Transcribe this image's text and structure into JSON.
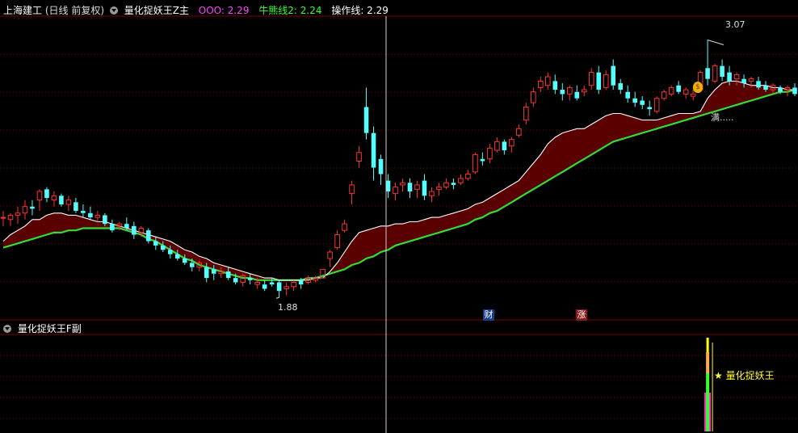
{
  "main_header": {
    "symbol": "上海建工",
    "period": "(日线 前复权)",
    "indicator": "量化捉妖王Z主",
    "ooo_label": "OOO: 2.29",
    "bear_label": "牛熊线2: 2.24",
    "op_label": "操作线: 2.29"
  },
  "sub_header": {
    "indicator": "量化捉妖王F副"
  },
  "annotations": {
    "high": "3.07",
    "low": "1.88",
    "full_text": "满.....",
    "cai_badge": "财",
    "zhang_badge": "涨",
    "signal_text": "★ 量化捉妖王"
  },
  "colors": {
    "up": "#ff3232",
    "down": "#54ffff",
    "green_line": "#33dd33",
    "white_line": "#ffffff",
    "fill_red": "#5a0000",
    "fill_green": "#0d4d0d",
    "grid": "#800000",
    "ooo_color": "#ff44ff",
    "bear_color": "#33ff33",
    "signal_yellow": "#ffff00",
    "signal_pink": "#ff33cc",
    "signal_green": "#33ff33",
    "signal_orange": "#ffaa55"
  },
  "chart_data": {
    "type": "candlestick",
    "series": [
      {
        "name": "ohlc",
        "values": [
          [
            2.25,
            2.28,
            2.21,
            2.25
          ],
          [
            2.24,
            2.27,
            2.21,
            2.26
          ],
          [
            2.26,
            2.3,
            2.22,
            2.27
          ],
          [
            2.27,
            2.33,
            2.24,
            2.3
          ],
          [
            2.3,
            2.33,
            2.26,
            2.29
          ],
          [
            2.33,
            2.38,
            2.28,
            2.37
          ],
          [
            2.38,
            2.39,
            2.32,
            2.34
          ],
          [
            2.33,
            2.37,
            2.3,
            2.35
          ],
          [
            2.35,
            2.36,
            2.3,
            2.31
          ],
          [
            2.31,
            2.35,
            2.28,
            2.33
          ],
          [
            2.32,
            2.34,
            2.27,
            2.28
          ],
          [
            2.28,
            2.31,
            2.25,
            2.27
          ],
          [
            2.27,
            2.3,
            2.24,
            2.25
          ],
          [
            2.25,
            2.28,
            2.23,
            2.26
          ],
          [
            2.26,
            2.27,
            2.21,
            2.22
          ],
          [
            2.22,
            2.24,
            2.18,
            2.19
          ],
          [
            2.21,
            2.23,
            2.19,
            2.22
          ],
          [
            2.22,
            2.25,
            2.19,
            2.2
          ],
          [
            2.21,
            2.23,
            2.15,
            2.17
          ],
          [
            2.18,
            2.21,
            2.16,
            2.2
          ],
          [
            2.19,
            2.2,
            2.13,
            2.14
          ],
          [
            2.14,
            2.16,
            2.1,
            2.12
          ],
          [
            2.12,
            2.14,
            2.09,
            2.1
          ],
          [
            2.1,
            2.12,
            2.06,
            2.08
          ],
          [
            2.08,
            2.1,
            2.05,
            2.06
          ],
          [
            2.06,
            2.08,
            2.03,
            2.04
          ],
          [
            2.04,
            2.06,
            2.0,
            2.02
          ],
          [
            2.02,
            2.05,
            2.0,
            2.04
          ],
          [
            2.02,
            2.04,
            1.95,
            1.97
          ],
          [
            2.01,
            2.03,
            1.96,
            1.99
          ],
          [
            1.99,
            2.02,
            1.97,
            2.0
          ],
          [
            2.0,
            2.02,
            1.96,
            1.97
          ],
          [
            1.97,
            1.99,
            1.94,
            1.95
          ],
          [
            1.95,
            1.99,
            1.93,
            1.98
          ],
          [
            1.97,
            1.99,
            1.94,
            1.96
          ],
          [
            1.94,
            1.97,
            1.92,
            1.95
          ],
          [
            1.94,
            1.96,
            1.91,
            1.92
          ],
          [
            1.95,
            1.97,
            1.93,
            1.94
          ],
          [
            1.95,
            1.96,
            1.88,
            1.91
          ],
          [
            1.92,
            1.95,
            1.89,
            1.93
          ],
          [
            1.93,
            1.96,
            1.91,
            1.95
          ],
          [
            1.96,
            1.97,
            1.92,
            1.94
          ],
          [
            1.95,
            1.98,
            1.94,
            1.97
          ],
          [
            1.96,
            1.98,
            1.95,
            1.97
          ],
          [
            1.97,
            2.01,
            1.97,
            2.01
          ],
          [
            2.06,
            2.1,
            2.02,
            2.09
          ],
          [
            2.11,
            2.19,
            2.1,
            2.17
          ],
          [
            2.19,
            2.24,
            2.18,
            2.22
          ],
          [
            2.36,
            2.42,
            2.31,
            2.4
          ],
          [
            2.51,
            2.58,
            2.48,
            2.55
          ],
          [
            2.76,
            2.85,
            2.61,
            2.64
          ],
          [
            2.64,
            2.67,
            2.42,
            2.48
          ],
          [
            2.52,
            2.54,
            2.4,
            2.45
          ],
          [
            2.42,
            2.45,
            2.34,
            2.37
          ],
          [
            2.36,
            2.41,
            2.33,
            2.39
          ],
          [
            2.4,
            2.43,
            2.37,
            2.41
          ],
          [
            2.41,
            2.43,
            2.34,
            2.37
          ],
          [
            2.38,
            2.42,
            2.34,
            2.4
          ],
          [
            2.42,
            2.45,
            2.33,
            2.35
          ],
          [
            2.35,
            2.39,
            2.32,
            2.37
          ],
          [
            2.38,
            2.41,
            2.35,
            2.39
          ],
          [
            2.39,
            2.43,
            2.38,
            2.41
          ],
          [
            2.41,
            2.43,
            2.38,
            2.4
          ],
          [
            2.41,
            2.45,
            2.4,
            2.43
          ],
          [
            2.43,
            2.47,
            2.42,
            2.45
          ],
          [
            2.46,
            2.55,
            2.45,
            2.54
          ],
          [
            2.52,
            2.55,
            2.49,
            2.51
          ],
          [
            2.52,
            2.59,
            2.5,
            2.57
          ],
          [
            2.56,
            2.62,
            2.55,
            2.6
          ],
          [
            2.6,
            2.61,
            2.54,
            2.56
          ],
          [
            2.58,
            2.62,
            2.55,
            2.61
          ],
          [
            2.63,
            2.68,
            2.62,
            2.66
          ],
          [
            2.7,
            2.78,
            2.68,
            2.76
          ],
          [
            2.78,
            2.85,
            2.76,
            2.83
          ],
          [
            2.85,
            2.9,
            2.83,
            2.88
          ],
          [
            2.86,
            2.92,
            2.84,
            2.9
          ],
          [
            2.88,
            2.91,
            2.82,
            2.84
          ],
          [
            2.84,
            2.87,
            2.79,
            2.82
          ],
          [
            2.82,
            2.86,
            2.79,
            2.85
          ],
          [
            2.83,
            2.86,
            2.79,
            2.8
          ],
          [
            2.83,
            2.86,
            2.81,
            2.84
          ],
          [
            2.86,
            2.94,
            2.84,
            2.92
          ],
          [
            2.92,
            2.95,
            2.82,
            2.84
          ],
          [
            2.85,
            2.93,
            2.84,
            2.91
          ],
          [
            2.95,
            2.98,
            2.84,
            2.86
          ],
          [
            2.87,
            2.89,
            2.82,
            2.84
          ],
          [
            2.83,
            2.86,
            2.78,
            2.8
          ],
          [
            2.8,
            2.83,
            2.76,
            2.78
          ],
          [
            2.79,
            2.81,
            2.75,
            2.77
          ],
          [
            2.76,
            2.79,
            2.72,
            2.75
          ],
          [
            2.74,
            2.81,
            2.73,
            2.8
          ],
          [
            2.8,
            2.84,
            2.79,
            2.83
          ],
          [
            2.82,
            2.86,
            2.81,
            2.85
          ],
          [
            2.86,
            2.88,
            2.82,
            2.83
          ],
          [
            2.82,
            2.85,
            2.8,
            2.84
          ],
          [
            2.81,
            2.84,
            2.79,
            2.82
          ],
          [
            2.84,
            2.93,
            2.83,
            2.92
          ],
          [
            2.94,
            3.07,
            2.86,
            2.89
          ],
          [
            2.88,
            2.96,
            2.87,
            2.95
          ],
          [
            2.95,
            2.98,
            2.88,
            2.9
          ],
          [
            2.92,
            2.95,
            2.86,
            2.88
          ],
          [
            2.89,
            2.92,
            2.86,
            2.91
          ],
          [
            2.89,
            2.91,
            2.85,
            2.87
          ],
          [
            2.88,
            2.9,
            2.85,
            2.89
          ],
          [
            2.88,
            2.9,
            2.84,
            2.85
          ],
          [
            2.86,
            2.88,
            2.83,
            2.84
          ],
          [
            2.84,
            2.87,
            2.82,
            2.86
          ],
          [
            2.85,
            2.86,
            2.82,
            2.83
          ],
          [
            2.84,
            2.86,
            2.81,
            2.85
          ],
          [
            2.85,
            2.87,
            2.81,
            2.82
          ]
        ]
      },
      {
        "name": "OOO",
        "values": [
          2.14,
          2.17,
          2.19,
          2.21,
          2.24,
          2.24,
          2.26,
          2.27,
          2.27,
          2.26,
          2.26,
          2.25,
          2.24,
          2.23,
          2.23,
          2.22,
          2.21,
          2.2,
          2.19,
          2.18,
          2.17,
          2.16,
          2.15,
          2.14,
          2.12,
          2.1,
          2.09,
          2.07,
          2.06,
          2.04,
          2.03,
          2.02,
          2.01,
          2.0,
          1.99,
          1.98,
          1.97,
          1.97,
          1.96,
          1.96,
          1.96,
          1.96,
          1.96,
          1.97,
          1.97,
          2.0,
          2.04,
          2.09,
          2.14,
          2.18,
          2.19,
          2.2,
          2.21,
          2.21,
          2.22,
          2.22,
          2.23,
          2.23,
          2.24,
          2.25,
          2.25,
          2.26,
          2.27,
          2.28,
          2.29,
          2.31,
          2.32,
          2.34,
          2.36,
          2.38,
          2.4,
          2.42,
          2.46,
          2.5,
          2.54,
          2.59,
          2.62,
          2.64,
          2.65,
          2.66,
          2.66,
          2.68,
          2.7,
          2.72,
          2.73,
          2.73,
          2.72,
          2.71,
          2.7,
          2.7,
          2.7,
          2.71,
          2.72,
          2.73,
          2.73,
          2.73,
          2.74,
          2.8,
          2.84,
          2.87,
          2.88,
          2.88,
          2.87,
          2.86,
          2.86,
          2.86,
          2.85,
          2.85,
          2.84,
          2.84
        ]
      },
      {
        "name": "牛熊线2",
        "values": [
          2.11,
          2.12,
          2.13,
          2.14,
          2.15,
          2.16,
          2.17,
          2.18,
          2.18,
          2.19,
          2.19,
          2.2,
          2.2,
          2.2,
          2.2,
          2.2,
          2.2,
          2.19,
          2.18,
          2.17,
          2.15,
          2.14,
          2.12,
          2.1,
          2.08,
          2.06,
          2.05,
          2.03,
          2.02,
          2.01,
          2.0,
          1.99,
          1.98,
          1.97,
          1.97,
          1.96,
          1.96,
          1.96,
          1.96,
          1.96,
          1.96,
          1.96,
          1.97,
          1.97,
          1.98,
          1.99,
          2.0,
          2.01,
          2.03,
          2.04,
          2.06,
          2.07,
          2.09,
          2.1,
          2.12,
          2.13,
          2.14,
          2.15,
          2.16,
          2.17,
          2.18,
          2.19,
          2.2,
          2.21,
          2.22,
          2.24,
          2.25,
          2.27,
          2.28,
          2.3,
          2.32,
          2.34,
          2.36,
          2.38,
          2.4,
          2.42,
          2.44,
          2.46,
          2.48,
          2.5,
          2.52,
          2.54,
          2.56,
          2.58,
          2.6,
          2.61,
          2.62,
          2.63,
          2.64,
          2.65,
          2.66,
          2.67,
          2.68,
          2.69,
          2.7,
          2.71,
          2.72,
          2.73,
          2.74,
          2.75,
          2.76,
          2.77,
          2.78,
          2.79,
          2.8,
          2.81,
          2.82,
          2.83,
          2.83,
          2.84
        ]
      },
      {
        "name": "量化捉妖王F副",
        "values": [
          0,
          0,
          0,
          0,
          0,
          0,
          0,
          0,
          0,
          0,
          0,
          0,
          0,
          0,
          0,
          0,
          0,
          0,
          0,
          0,
          0,
          0,
          0,
          0,
          0,
          0,
          0,
          0,
          0,
          0,
          0,
          0,
          0,
          0,
          0,
          0,
          0,
          0,
          0,
          0,
          0,
          0,
          0,
          0,
          0,
          0,
          0,
          0,
          0,
          0,
          0,
          0,
          0,
          0,
          0,
          0,
          0,
          0,
          0,
          0,
          0,
          0,
          0,
          0,
          0,
          0,
          0,
          0,
          0,
          0,
          0,
          0,
          0,
          0,
          0,
          0,
          0,
          0,
          0,
          0,
          0,
          0,
          0,
          0,
          0,
          0,
          0,
          0,
          0,
          0,
          0,
          0,
          0,
          0,
          0,
          0,
          0,
          1,
          0,
          0,
          0,
          0,
          0,
          0,
          0,
          0,
          0,
          0,
          0,
          0
        ]
      }
    ],
    "ylim": [
      1.78,
      3.18
    ],
    "grid": true
  }
}
